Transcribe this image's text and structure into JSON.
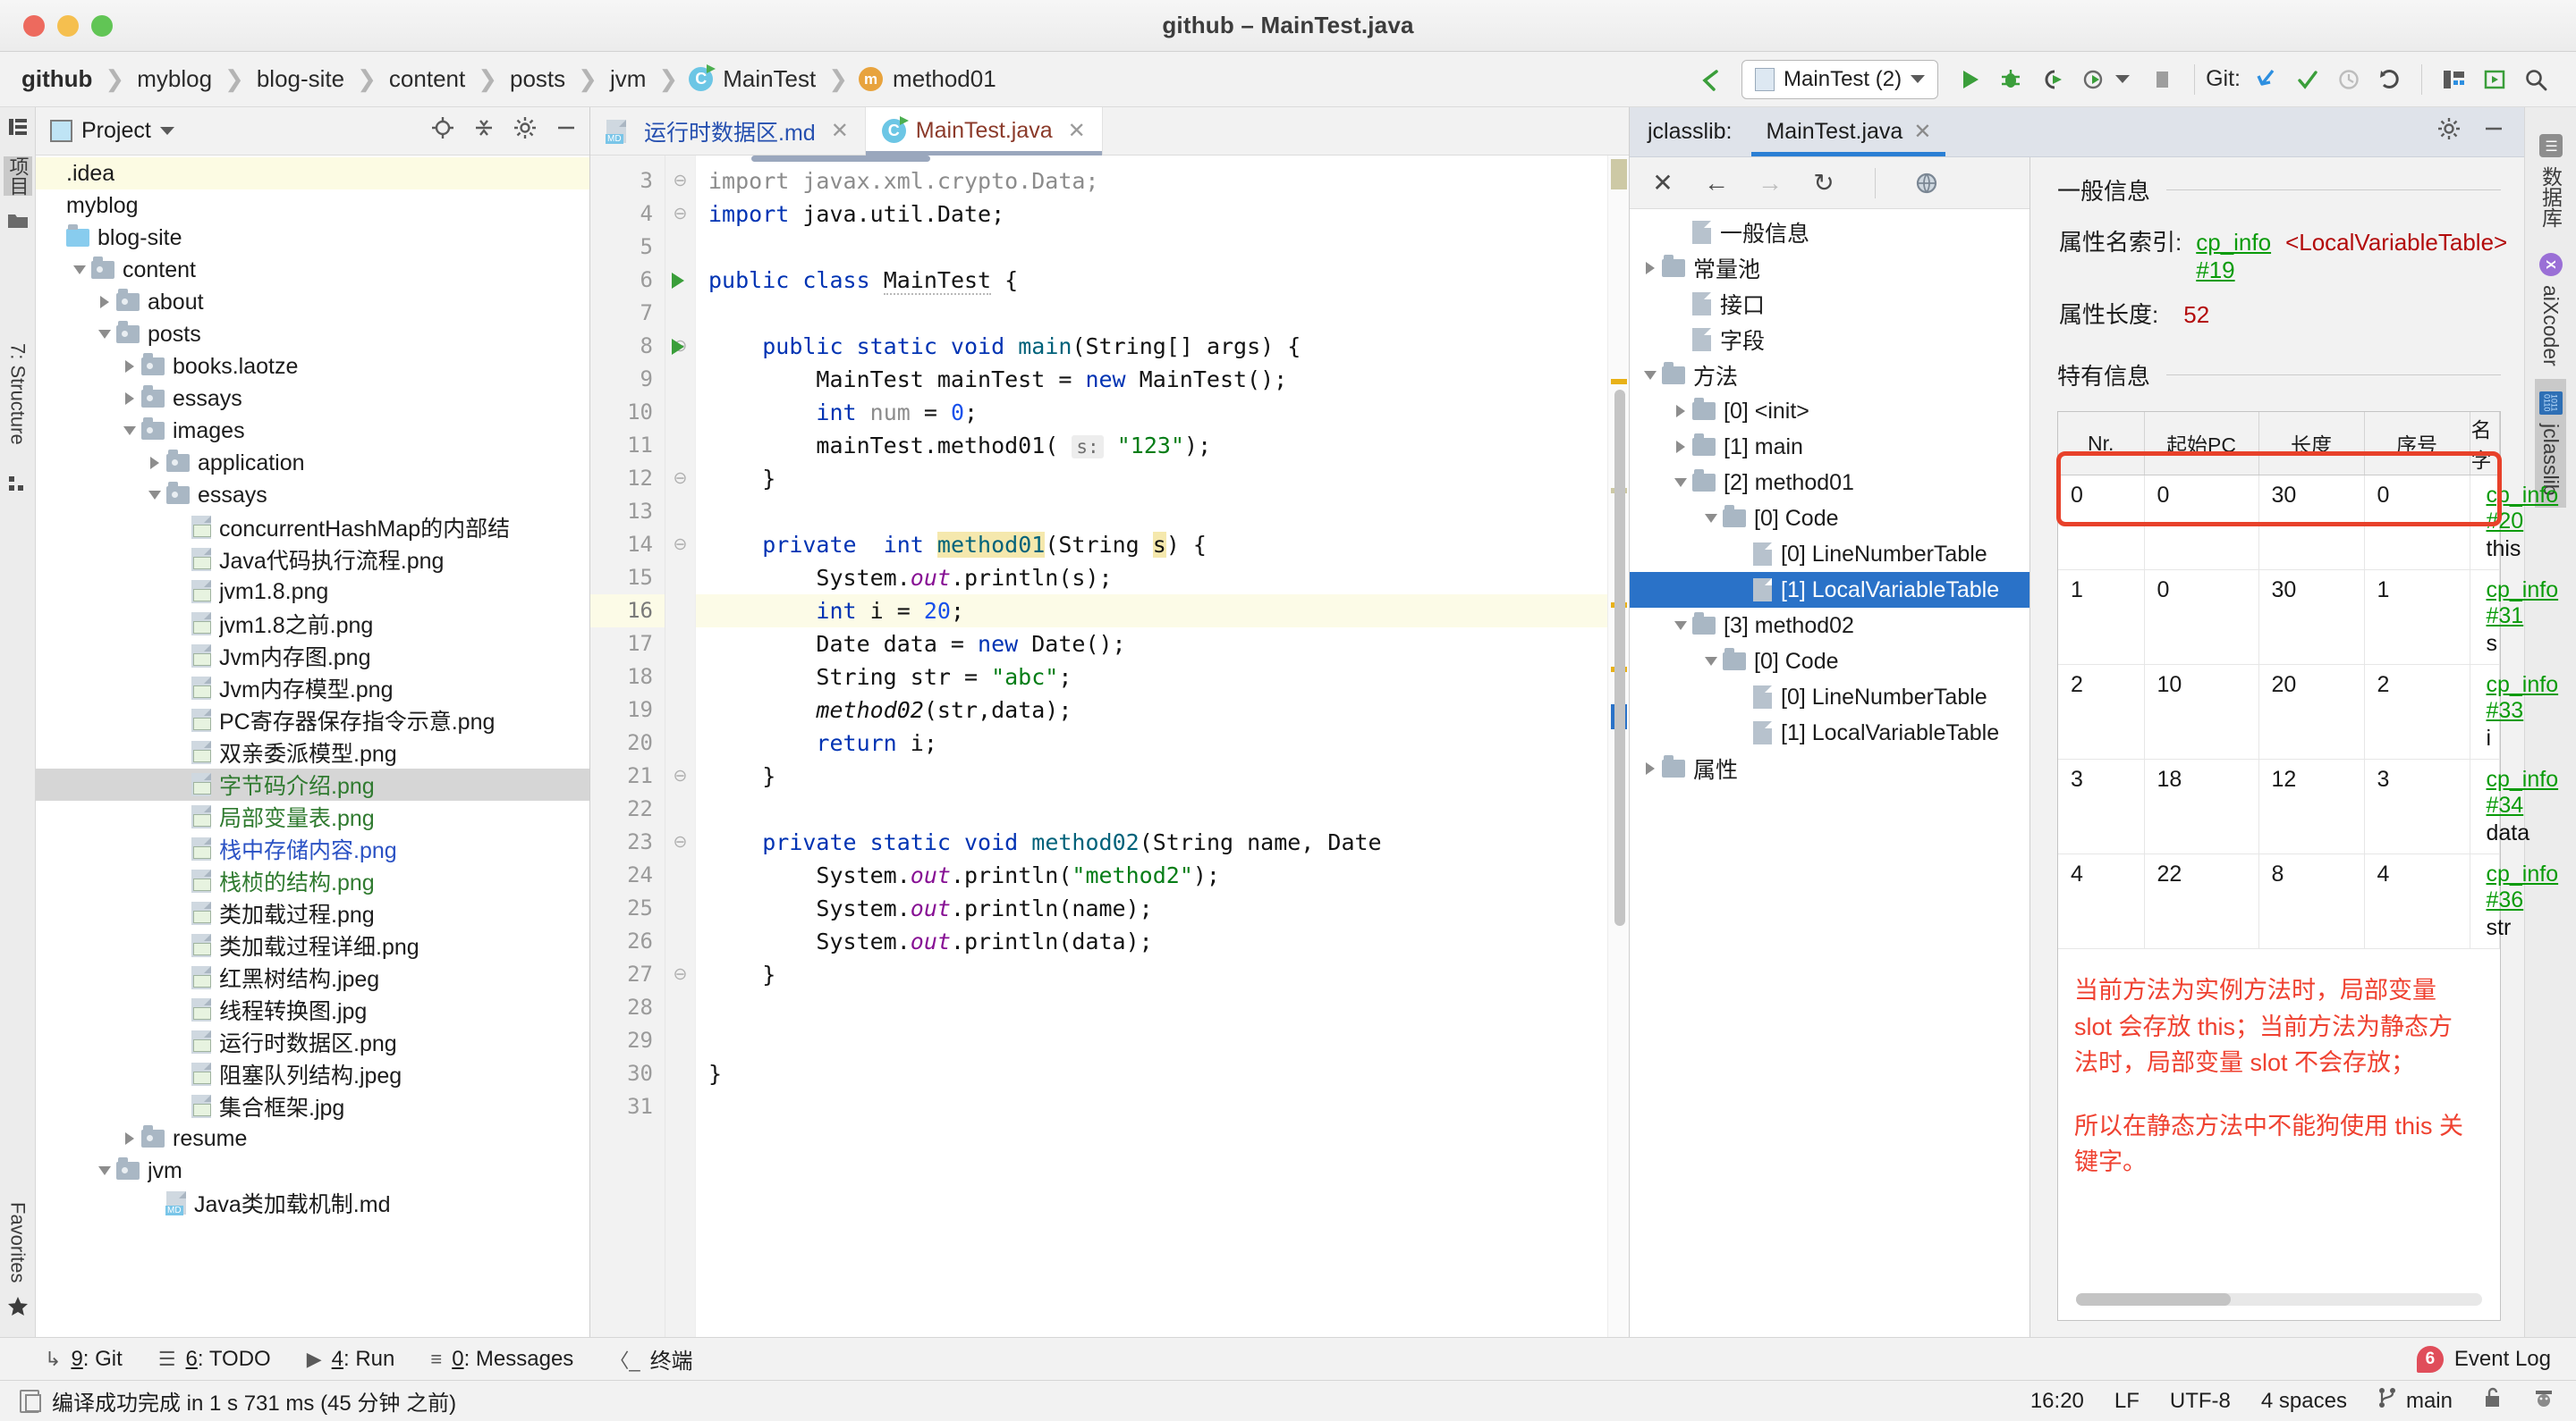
{
  "window": {
    "title": "github – MainTest.java"
  },
  "breadcrumb": {
    "items": [
      "github",
      "myblog",
      "blog-site",
      "content",
      "posts",
      "jvm"
    ],
    "class_item": "MainTest",
    "class_icon_letter": "C",
    "method_item": "method01",
    "method_icon_letter": "m"
  },
  "toolbar": {
    "run_config": "MainTest (2)",
    "git_label": "Git:",
    "icons": [
      "back-arrow-icon",
      "run-icon",
      "debug-icon",
      "run-with-coverage-icon",
      "profile-icon",
      "stop-icon",
      "update-project-icon",
      "commit-icon",
      "rollback-icon",
      "layout-icon",
      "preview-icon",
      "search-everywhere-icon"
    ]
  },
  "left_strip": {
    "top": "项目",
    "structure": "7: Structure",
    "bottom": "Favorites"
  },
  "project": {
    "title": "Project",
    "root_path": "/github",
    "tree": [
      {
        "label": ".idea",
        "indent": 0,
        "twisty": "none",
        "icon": "none",
        "state": "hl-yellow"
      },
      {
        "label": "myblog",
        "indent": 0,
        "twisty": "none",
        "icon": "none",
        "state": ""
      },
      {
        "label": "blog-site",
        "indent": 0,
        "twisty": "none",
        "icon": "folder-blue",
        "state": ""
      },
      {
        "label": "content",
        "indent": 1,
        "twisty": "open",
        "icon": "folder-src",
        "state": ""
      },
      {
        "label": "about",
        "indent": 2,
        "twisty": "closed",
        "icon": "folder-src",
        "state": ""
      },
      {
        "label": "posts",
        "indent": 2,
        "twisty": "open",
        "icon": "folder-src",
        "state": ""
      },
      {
        "label": "books.laotze",
        "indent": 3,
        "twisty": "closed",
        "icon": "folder-src",
        "state": ""
      },
      {
        "label": "essays",
        "indent": 3,
        "twisty": "closed",
        "icon": "folder-src",
        "state": ""
      },
      {
        "label": "images",
        "indent": 3,
        "twisty": "open",
        "icon": "folder-src",
        "state": ""
      },
      {
        "label": "application",
        "indent": 4,
        "twisty": "closed",
        "icon": "folder-src",
        "state": ""
      },
      {
        "label": "essays",
        "indent": 4,
        "twisty": "open",
        "icon": "folder-src",
        "state": ""
      },
      {
        "label": "concurrentHashMap的内部结",
        "indent": 5,
        "twisty": "none",
        "icon": "file-img",
        "state": ""
      },
      {
        "label": "Java代码执行流程.png",
        "indent": 5,
        "twisty": "none",
        "icon": "file-img",
        "state": ""
      },
      {
        "label": "jvm1.8.png",
        "indent": 5,
        "twisty": "none",
        "icon": "file-img",
        "state": ""
      },
      {
        "label": "jvm1.8之前.png",
        "indent": 5,
        "twisty": "none",
        "icon": "file-img",
        "state": ""
      },
      {
        "label": "Jvm内存图.png",
        "indent": 5,
        "twisty": "none",
        "icon": "file-img",
        "state": ""
      },
      {
        "label": "Jvm内存模型.png",
        "indent": 5,
        "twisty": "none",
        "icon": "file-img",
        "state": ""
      },
      {
        "label": "PC寄存器保存指令示意.png",
        "indent": 5,
        "twisty": "none",
        "icon": "file-img",
        "state": ""
      },
      {
        "label": "双亲委派模型.png",
        "indent": 5,
        "twisty": "none",
        "icon": "file-img",
        "state": ""
      },
      {
        "label": "字节码介绍.png",
        "indent": 5,
        "twisty": "none",
        "icon": "file-img",
        "state": "hl-gray",
        "color": "green"
      },
      {
        "label": "局部变量表.png",
        "indent": 5,
        "twisty": "none",
        "icon": "file-img",
        "state": "",
        "color": "green"
      },
      {
        "label": "栈中存储内容.png",
        "indent": 5,
        "twisty": "none",
        "icon": "file-img",
        "state": "",
        "color": "blue"
      },
      {
        "label": "栈桢的结构.png",
        "indent": 5,
        "twisty": "none",
        "icon": "file-img",
        "state": "",
        "color": "green"
      },
      {
        "label": "类加载过程.png",
        "indent": 5,
        "twisty": "none",
        "icon": "file-img",
        "state": ""
      },
      {
        "label": "类加载过程详细.png",
        "indent": 5,
        "twisty": "none",
        "icon": "file-img",
        "state": ""
      },
      {
        "label": "红黑树结构.jpeg",
        "indent": 5,
        "twisty": "none",
        "icon": "file-img",
        "state": ""
      },
      {
        "label": "线程转换图.jpg",
        "indent": 5,
        "twisty": "none",
        "icon": "file-img",
        "state": ""
      },
      {
        "label": "运行时数据区.png",
        "indent": 5,
        "twisty": "none",
        "icon": "file-img",
        "state": ""
      },
      {
        "label": "阻塞队列结构.jpeg",
        "indent": 5,
        "twisty": "none",
        "icon": "file-img",
        "state": ""
      },
      {
        "label": "集合框架.jpg",
        "indent": 5,
        "twisty": "none",
        "icon": "file-img",
        "state": ""
      },
      {
        "label": "resume",
        "indent": 3,
        "twisty": "closed",
        "icon": "folder-src",
        "state": ""
      },
      {
        "label": "jvm",
        "indent": 2,
        "twisty": "open",
        "icon": "folder-src",
        "state": ""
      },
      {
        "label": "Java类加载机制.md",
        "indent": 4,
        "twisty": "none",
        "icon": "file-md",
        "state": ""
      }
    ]
  },
  "editor": {
    "tabs": [
      {
        "label": "运行时数据区.md",
        "icon": "md-file-icon",
        "active": false
      },
      {
        "label": "MainTest.java",
        "icon": "java-class-icon",
        "active": true
      }
    ],
    "first_line": 3,
    "current_line": 16,
    "lines": [
      {
        "n": 3,
        "html": "<span class=\"gray\">import javax.xml.crypto.Data;</span>"
      },
      {
        "n": 4,
        "html": "<span class=\"kw\">import</span> java.util.Date;"
      },
      {
        "n": 5,
        "html": ""
      },
      {
        "n": 6,
        "html": "<span class=\"kw\">public class</span> <span class=\"wavy\">MainTest</span> {"
      },
      {
        "n": 7,
        "html": ""
      },
      {
        "n": 8,
        "html": "    <span class=\"kw\">public static void</span> <span class=\"mth\">main</span>(String[] args) {"
      },
      {
        "n": 9,
        "html": "        MainTest mainTest = <span class=\"kw\">new</span> MainTest();"
      },
      {
        "n": 10,
        "html": "        <span class=\"kw\">int</span> <span class=\"gray\">num</span> = <span class=\"num\">0</span>;"
      },
      {
        "n": 11,
        "html": "        mainTest.method01( <span class=\"hint\">s:</span> <span class=\"str\">\"123\"</span>);"
      },
      {
        "n": 12,
        "html": "    }"
      },
      {
        "n": 13,
        "html": ""
      },
      {
        "n": 14,
        "html": "    <span class=\"kw\">private</span>  <span class=\"kw\">int</span> <span class=\"mth hlident\">method01</span>(String <span class=\"hlident\">s</span>) {"
      },
      {
        "n": 15,
        "html": "        System.<span class=\"fld\">out</span>.println(s);"
      },
      {
        "n": 16,
        "html": "        <span class=\"kw\">int</span> i = <span class=\"num\">20</span>;"
      },
      {
        "n": 17,
        "html": "        Date data = <span class=\"kw\">new</span> Date();"
      },
      {
        "n": 18,
        "html": "        String str = <span class=\"str\">\"abc\"</span>;"
      },
      {
        "n": 19,
        "html": "        <span class=\"ital\">method02</span>(str,data);"
      },
      {
        "n": 20,
        "html": "        <span class=\"kw\">return</span> i;"
      },
      {
        "n": 21,
        "html": "    }"
      },
      {
        "n": 22,
        "html": ""
      },
      {
        "n": 23,
        "html": "    <span class=\"kw\">private static void</span> <span class=\"mth\">method02</span>(String name, Date"
      },
      {
        "n": 24,
        "html": "        System.<span class=\"fld\">out</span>.println(<span class=\"str\">\"method2\"</span>);"
      },
      {
        "n": 25,
        "html": "        System.<span class=\"fld\">out</span>.println(name);"
      },
      {
        "n": 26,
        "html": "        System.<span class=\"fld\">out</span>.println(data);"
      },
      {
        "n": 27,
        "html": "    }"
      },
      {
        "n": 28,
        "html": ""
      },
      {
        "n": 29,
        "html": ""
      },
      {
        "n": 30,
        "html": "}"
      },
      {
        "n": 31,
        "html": ""
      }
    ],
    "run_gutter_lines": [
      6,
      8
    ],
    "fold_lines": [
      3,
      4,
      8,
      12,
      14,
      21,
      23,
      27
    ]
  },
  "jclasslib": {
    "panel_label": "jclasslib:",
    "tab_label": "MainTest.java",
    "toolbar_icons": [
      "close-icon",
      "back-icon",
      "forward-icon",
      "reload-icon",
      "browse-icon"
    ],
    "tree": [
      {
        "label": "一般信息",
        "indent": 1,
        "twisty": "none",
        "icon": "file",
        "sel": false
      },
      {
        "label": "常量池",
        "indent": 0,
        "twisty": "closed",
        "icon": "folder",
        "sel": false
      },
      {
        "label": "接口",
        "indent": 1,
        "twisty": "none",
        "icon": "file",
        "sel": false
      },
      {
        "label": "字段",
        "indent": 1,
        "twisty": "none",
        "icon": "file",
        "sel": false
      },
      {
        "label": "方法",
        "indent": 0,
        "twisty": "open",
        "icon": "folder",
        "sel": false
      },
      {
        "label": "[0] <init>",
        "indent": 1,
        "twisty": "closed",
        "icon": "folder",
        "sel": false
      },
      {
        "label": "[1] main",
        "indent": 1,
        "twisty": "closed",
        "icon": "folder",
        "sel": false
      },
      {
        "label": "[2] method01",
        "indent": 1,
        "twisty": "open",
        "icon": "folder",
        "sel": false
      },
      {
        "label": "[0] Code",
        "indent": 2,
        "twisty": "open",
        "icon": "folder",
        "sel": false
      },
      {
        "label": "[0] LineNumberTable",
        "indent": 3,
        "twisty": "none",
        "icon": "file",
        "sel": false
      },
      {
        "label": "[1] LocalVariableTable",
        "indent": 3,
        "twisty": "none",
        "icon": "file",
        "sel": true
      },
      {
        "label": "[3] method02",
        "indent": 1,
        "twisty": "open",
        "icon": "folder",
        "sel": false
      },
      {
        "label": "[0] Code",
        "indent": 2,
        "twisty": "open",
        "icon": "folder",
        "sel": false
      },
      {
        "label": "[0] LineNumberTable",
        "indent": 3,
        "twisty": "none",
        "icon": "file",
        "sel": false
      },
      {
        "label": "[1] LocalVariableTable",
        "indent": 3,
        "twisty": "none",
        "icon": "file",
        "sel": false
      },
      {
        "label": "属性",
        "indent": 0,
        "twisty": "closed",
        "icon": "folder",
        "sel": false
      }
    ],
    "detail": {
      "general_section": "一般信息",
      "attr_name_label": "属性名索引:",
      "attr_name_link": "cp_info #19",
      "attr_name_value": "<LocalVariableTable>",
      "attr_len_label": "属性长度:",
      "attr_len_value": "52",
      "specific_section": "特有信息",
      "columns": [
        "Nr.",
        "起始PC",
        "长度",
        "序号",
        "名字"
      ],
      "rows": [
        {
          "nr": "0",
          "start_pc": "0",
          "length": "30",
          "index": "0",
          "cp": "cp_info #20",
          "name": "this"
        },
        {
          "nr": "1",
          "start_pc": "0",
          "length": "30",
          "index": "1",
          "cp": "cp_info #31",
          "name": "s"
        },
        {
          "nr": "2",
          "start_pc": "10",
          "length": "20",
          "index": "2",
          "cp": "cp_info #33",
          "name": "i"
        },
        {
          "nr": "3",
          "start_pc": "18",
          "length": "12",
          "index": "3",
          "cp": "cp_info #34",
          "name": "data"
        },
        {
          "nr": "4",
          "start_pc": "22",
          "length": "8",
          "index": "4",
          "cp": "cp_info #36",
          "name": "str"
        }
      ],
      "note_1": "当前方法为实例方法时，局部变量 slot 会存放 this；当前方法为静态方法时，局部变量 slot 不会存放；",
      "note_2": "所以在静态方法中不能狗使用 this 关键字。",
      "highlight_color": "#e8412a",
      "note_color": "#ef4130"
    }
  },
  "right_strip": {
    "tabs": [
      {
        "label": "数据库",
        "icon": "database-icon",
        "selected": false
      },
      {
        "label": "aiXcoder",
        "icon": "aixcoder-icon",
        "selected": false
      },
      {
        "label": "jclasslib",
        "icon": "jclasslib-icon",
        "selected": true
      }
    ]
  },
  "bottom_bar": {
    "items": [
      {
        "num": "9",
        "label": "Git",
        "icon": "git-branch-icon"
      },
      {
        "num": "6",
        "label": "TODO",
        "icon": "todo-list-icon"
      },
      {
        "num": "4",
        "label": "Run",
        "icon": "run-triangle-icon"
      },
      {
        "num": "0",
        "label": "Messages",
        "icon": "messages-icon"
      }
    ],
    "terminal": "终端",
    "event_log": "Event Log",
    "event_count": "6"
  },
  "status_bar": {
    "message": "编译成功完成 in 1 s 731 ms (45 分钟 之前)",
    "time": "16:20",
    "line_sep": "LF",
    "encoding": "UTF-8",
    "indent": "4 spaces",
    "branch": "main",
    "icons": [
      "lock-open-icon",
      "inspector-icon"
    ]
  }
}
